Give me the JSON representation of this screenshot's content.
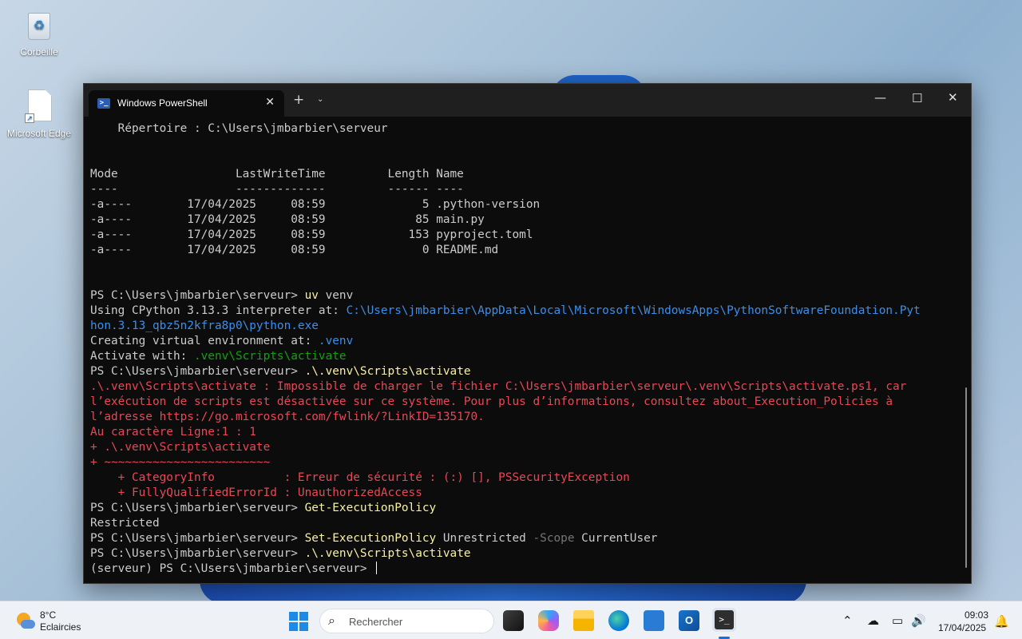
{
  "desktop": {
    "icons": [
      {
        "label": "Corbeille"
      },
      {
        "label": "Microsoft Edge"
      }
    ]
  },
  "window": {
    "tab_title": "Windows PowerShell",
    "tab_icon_text": ">_",
    "close_tab_glyph": "✕",
    "new_tab_glyph": "+",
    "dropdown_glyph": "⌄",
    "minimize_glyph": "—",
    "maximize_glyph": "☐",
    "close_glyph": "✕"
  },
  "console": {
    "lines": [
      [
        {
          "t": "    Répertoire : C:\\Users\\jmbarbier\\serveur",
          "c": "w"
        }
      ],
      [
        {
          "t": "",
          "c": "w"
        }
      ],
      [
        {
          "t": "",
          "c": "w"
        }
      ],
      [
        {
          "t": "Mode                 LastWriteTime         Length Name",
          "c": "w"
        }
      ],
      [
        {
          "t": "----                 -------------         ------ ----",
          "c": "w"
        }
      ],
      [
        {
          "t": "-a----        17/04/2025     08:59              5 .python-version",
          "c": "w"
        }
      ],
      [
        {
          "t": "-a----        17/04/2025     08:59             85 main.py",
          "c": "w"
        }
      ],
      [
        {
          "t": "-a----        17/04/2025     08:59            153 pyproject.toml",
          "c": "w"
        }
      ],
      [
        {
          "t": "-a----        17/04/2025     08:59              0 README.md",
          "c": "w"
        }
      ],
      [
        {
          "t": "",
          "c": "w"
        }
      ],
      [
        {
          "t": "",
          "c": "w"
        }
      ],
      [
        {
          "t": "PS C:\\Users\\jmbarbier\\serveur> ",
          "c": "w"
        },
        {
          "t": "uv",
          "c": "y"
        },
        {
          "t": " venv",
          "c": "w"
        }
      ],
      [
        {
          "t": "Using CPython 3.13.3 interpreter at: ",
          "c": "w"
        },
        {
          "t": "C:\\Users\\jmbarbier\\AppData\\Local\\Microsoft\\WindowsApps\\PythonSoftwareFoundation.Pyt",
          "c": "b"
        }
      ],
      [
        {
          "t": "hon.3.13_qbz5n2kfra8p0\\python.exe",
          "c": "b"
        }
      ],
      [
        {
          "t": "Creating virtual environment at: ",
          "c": "w"
        },
        {
          "t": ".venv",
          "c": "b"
        }
      ],
      [
        {
          "t": "Activate with: ",
          "c": "w"
        },
        {
          "t": ".venv\\Scripts\\activate",
          "c": "g"
        }
      ],
      [
        {
          "t": "PS C:\\Users\\jmbarbier\\serveur> ",
          "c": "w"
        },
        {
          "t": ".\\.venv\\Scripts\\activate",
          "c": "y"
        }
      ],
      [
        {
          "t": ".\\.venv\\Scripts\\activate : Impossible de charger le fichier C:\\Users\\jmbarbier\\serveur\\.venv\\Scripts\\activate.ps1, car",
          "c": "r"
        }
      ],
      [
        {
          "t": "l’exécution de scripts est désactivée sur ce système. Pour plus d’informations, consultez about_Execution_Policies à",
          "c": "r"
        }
      ],
      [
        {
          "t": "l’adresse https://go.microsoft.com/fwlink/?LinkID=135170.",
          "c": "r"
        }
      ],
      [
        {
          "t": "Au caractère Ligne:1 : 1",
          "c": "r"
        }
      ],
      [
        {
          "t": "+ .\\.venv\\Scripts\\activate",
          "c": "r"
        }
      ],
      [
        {
          "t": "+ ~~~~~~~~~~~~~~~~~~~~~~~~",
          "c": "r"
        }
      ],
      [
        {
          "t": "    + CategoryInfo          : Erreur de sécurité : (:) [], PSSecurityException",
          "c": "r"
        }
      ],
      [
        {
          "t": "    + FullyQualifiedErrorId : UnauthorizedAccess",
          "c": "r"
        }
      ],
      [
        {
          "t": "PS C:\\Users\\jmbarbier\\serveur> ",
          "c": "w"
        },
        {
          "t": "Get-ExecutionPolicy",
          "c": "y"
        }
      ],
      [
        {
          "t": "Restricted",
          "c": "w"
        }
      ],
      [
        {
          "t": "PS C:\\Users\\jmbarbier\\serveur> ",
          "c": "w"
        },
        {
          "t": "Set-ExecutionPolicy",
          "c": "y"
        },
        {
          "t": " Unrestricted ",
          "c": "w"
        },
        {
          "t": "-Scope",
          "c": "gr"
        },
        {
          "t": " CurrentUser",
          "c": "w"
        }
      ],
      [
        {
          "t": "PS C:\\Users\\jmbarbier\\serveur> ",
          "c": "w"
        },
        {
          "t": ".\\.venv\\Scripts\\activate",
          "c": "y"
        }
      ],
      [
        {
          "t": "(serveur) PS C:\\Users\\jmbarbier\\serveur> ",
          "c": "w"
        }
      ]
    ]
  },
  "taskbar": {
    "weather_temp": "8°C",
    "weather_condition": "Eclaircies",
    "search_placeholder": "Rechercher",
    "search_glyph": "⌕",
    "outlook_letter": "O",
    "terminal_glyph": ">_",
    "tray_chevron": "⌃",
    "tray_onedrive": "☁",
    "tray_network": "▭",
    "tray_volume": "🔊",
    "tray_notification": "🔔",
    "clock_time": "09:03",
    "clock_date": "17/04/2025"
  },
  "colors": {
    "console_bg": "#0c0c0c",
    "text_default": "#cccccc",
    "command_yellow": "#f9f1a5",
    "path_blue": "#3b8eea",
    "activate_green": "#13a10e",
    "error_red": "#e74856",
    "param_gray": "#767676"
  }
}
